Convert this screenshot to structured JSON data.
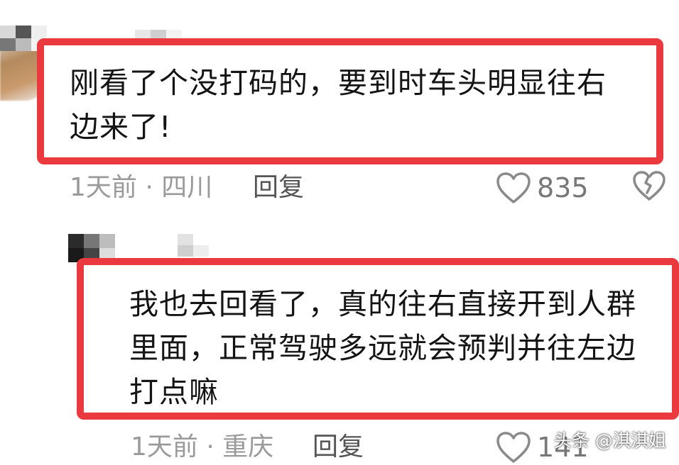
{
  "comments": [
    {
      "text_line1": "刚看了个没打码的，要到时车头明显往右",
      "text_line2": "边来了!",
      "time_location": "1天前 · 四川",
      "reply_label": "回复",
      "like_count": "835"
    },
    {
      "text_line1": "我也去回看了，真的往右直接开到人群",
      "text_line2": "里面，正常驾驶多远就会预判并往左边",
      "text_line3": "打点嘛",
      "time_location": "1天前 · 重庆",
      "reply_label": "回复",
      "like_count": "141"
    }
  ],
  "watermark": "头条 @淇淇姐",
  "colors": {
    "highlight_red": "#ea3a3f",
    "meta_gray": "#9a9a9a",
    "text_dark": "#141414"
  },
  "icons": {
    "like": "heart-outline-icon",
    "dislike": "broken-heart-icon"
  }
}
